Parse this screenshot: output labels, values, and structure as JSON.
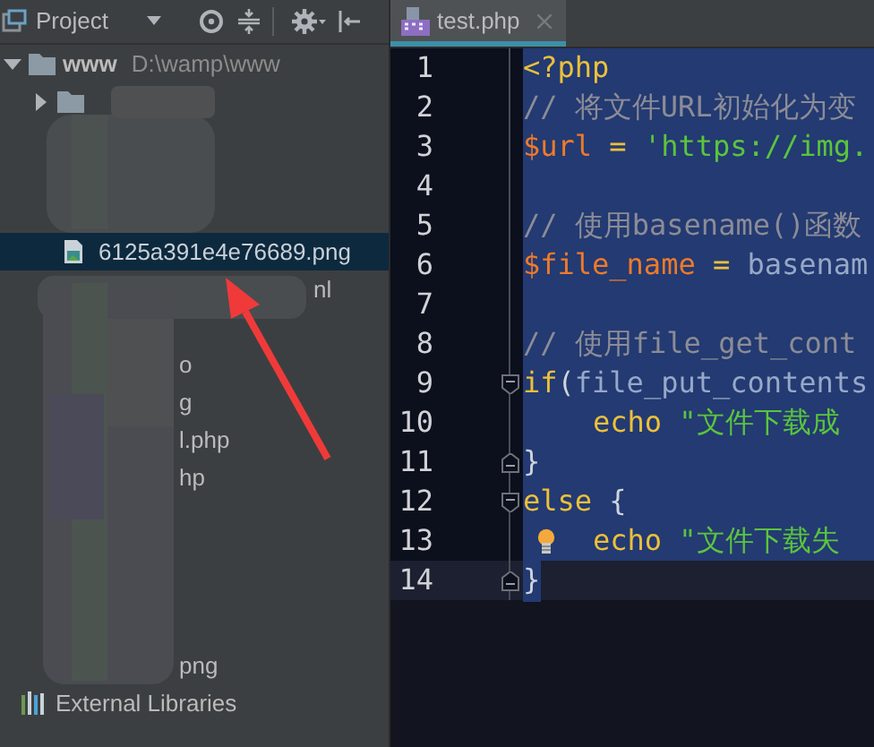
{
  "project_panel": {
    "title": "Project"
  },
  "tree": [
    {
      "kind": "folder",
      "label": "www",
      "path": "D:\\wamp\\www",
      "expanded": true,
      "selected": false,
      "children": [
        {
          "kind": "folder",
          "expanded": false,
          "selected": false
        },
        {
          "kind": "hidden",
          "selected": false
        },
        {
          "kind": "hidden",
          "selected": false
        },
        {
          "kind": "hidden",
          "selected": false
        },
        {
          "kind": "image",
          "label": "6125a391e4e76689.png",
          "selected": true
        },
        {
          "kind": "fragment-far",
          "label": "nl",
          "selected": false
        },
        {
          "kind": "hidden",
          "selected": false
        },
        {
          "kind": "fragment",
          "label": "o",
          "selected": false
        },
        {
          "kind": "fragment",
          "label": "g",
          "selected": false
        },
        {
          "kind": "fragment",
          "label": "l.php",
          "selected": false
        },
        {
          "kind": "fragment",
          "label": "hp",
          "selected": false
        },
        {
          "kind": "hidden",
          "selected": false
        },
        {
          "kind": "hidden",
          "selected": false
        },
        {
          "kind": "hidden",
          "selected": false
        },
        {
          "kind": "hidden",
          "selected": false
        },
        {
          "kind": "fragment",
          "label": "png",
          "selected": false
        }
      ]
    },
    {
      "kind": "libraries",
      "label": "External Libraries",
      "selected": false
    }
  ],
  "editor_tabs": [
    {
      "label": "test.php",
      "selected": true
    }
  ],
  "lines": [
    {
      "number": "1",
      "selected": true,
      "tokens": [
        {
          "kind": "keyword",
          "text": "<?php"
        }
      ]
    },
    {
      "number": "2",
      "selected": true,
      "tokens": [
        {
          "kind": "comment",
          "text": "// 将文件URL初始化为变"
        }
      ]
    },
    {
      "number": "3",
      "selected": true,
      "tokens": [
        {
          "kind": "variable",
          "text": "$url"
        },
        {
          "kind": "keyword",
          "text": " = "
        },
        {
          "kind": "string",
          "text": "'https://img."
        }
      ]
    },
    {
      "number": "4",
      "selected": true
    },
    {
      "number": "5",
      "selected": true,
      "tokens": [
        {
          "kind": "comment",
          "text": "// 使用basename()函数"
        }
      ]
    },
    {
      "number": "6",
      "selected": true,
      "tokens": [
        {
          "kind": "variable",
          "text": "$file_name"
        },
        {
          "kind": "keyword",
          "text": " = "
        },
        {
          "kind": "function",
          "text": "basenam"
        }
      ]
    },
    {
      "number": "7",
      "selected": true
    },
    {
      "number": "8",
      "selected": true,
      "tokens": [
        {
          "kind": "comment",
          "text": "// 使用file_get_cont"
        }
      ]
    },
    {
      "number": "9",
      "selected": true,
      "fold_open": true,
      "tokens": [
        {
          "kind": "keyword",
          "text": "if"
        },
        {
          "kind": "plain",
          "text": "("
        },
        {
          "kind": "function",
          "text": "file_put_contents"
        }
      ]
    },
    {
      "number": "10",
      "selected": true,
      "indented": true,
      "tokens": [
        {
          "kind": "keyword",
          "text": "echo "
        },
        {
          "kind": "string",
          "text": "\"文件下载成"
        }
      ]
    },
    {
      "number": "11",
      "selected": true,
      "fold_close": true,
      "tokens": [
        {
          "kind": "plain",
          "text": "}"
        }
      ]
    },
    {
      "number": "12",
      "selected": true,
      "fold_open": true,
      "tokens": [
        {
          "kind": "keyword",
          "text": "else "
        },
        {
          "kind": "plain",
          "text": "{"
        }
      ]
    },
    {
      "number": "13",
      "selected": true,
      "bulb": true,
      "indented": true,
      "tokens": [
        {
          "kind": "keyword",
          "text": "echo "
        },
        {
          "kind": "string",
          "text": "\"文件下载失"
        }
      ]
    },
    {
      "number": "14",
      "selected": true,
      "current": true,
      "fold_close": true,
      "tokens": [
        {
          "kind": "plain",
          "text": "}"
        }
      ]
    }
  ]
}
